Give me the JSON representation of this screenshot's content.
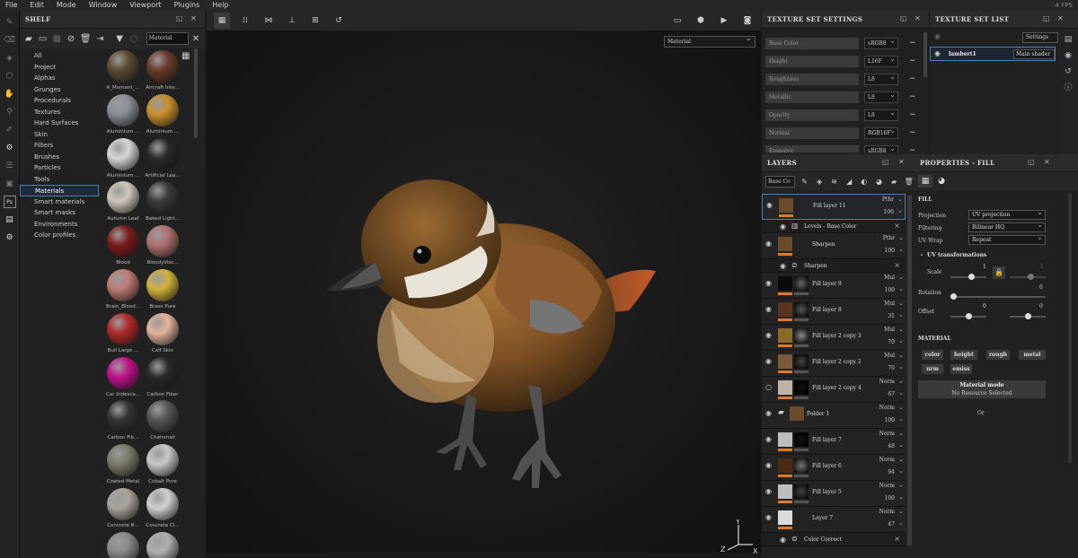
{
  "app": {
    "fps": "4 FPS"
  },
  "menu": [
    "File",
    "Edit",
    "Mode",
    "Window",
    "Viewport",
    "Plugins",
    "Help"
  ],
  "shelf": {
    "title": "SHELF",
    "search_value": "Material",
    "categories": [
      "All",
      "Project",
      "Alphas",
      "Grunges",
      "Procedurals",
      "Textures",
      "Hard Surfaces",
      "Skin",
      "Filters",
      "Brushes",
      "Particles",
      "Tools",
      "Materials",
      "Smart materials",
      "Smart masks",
      "Environments",
      "Color profiles"
    ],
    "selected_category": "Materials",
    "materials": [
      {
        "label": "A_Moment_...",
        "color": "#5a4a32"
      },
      {
        "label": "Aircraft Inte...",
        "color": "#6a3a2a"
      },
      {
        "label": "Aluminium ...",
        "color": "#8a8f95"
      },
      {
        "label": "Aluminium ...",
        "color": "#c9902c"
      },
      {
        "label": "Aluminium ...",
        "color": "#d8d8d8"
      },
      {
        "label": "Artificial Lea...",
        "color": "#2a2a2a"
      },
      {
        "label": "Autumn Leaf",
        "color": "#cfc7bb"
      },
      {
        "label": "Baked Light...",
        "color": "#3a3a3a"
      },
      {
        "label": "Blood",
        "color": "#7a1a1a"
      },
      {
        "label": "BloodyVisc...",
        "color": "#b07070"
      },
      {
        "label": "Brain_Blood...",
        "color": "#c07a74"
      },
      {
        "label": "Brass Pure",
        "color": "#d3b23a"
      },
      {
        "label": "Bull Large ...",
        "color": "#b02828"
      },
      {
        "label": "Calf Skin",
        "color": "#e4b39a"
      },
      {
        "label": "Car Iridesce...",
        "color": "#c0108a"
      },
      {
        "label": "Carbon Fiber",
        "color": "#2a2a2a"
      },
      {
        "label": "Carbon Fib...",
        "color": "#333333"
      },
      {
        "label": "Chainmail",
        "color": "#555555"
      },
      {
        "label": "Coated Metal",
        "color": "#7a7a68"
      },
      {
        "label": "Cobalt Pure",
        "color": "#c8c8c8"
      },
      {
        "label": "Concrete B...",
        "color": "#a8a49c"
      },
      {
        "label": "Concrete Cl...",
        "color": "#d0d0d0"
      },
      {
        "label": "",
        "color": "#8a8a8a"
      },
      {
        "label": "",
        "color": "#b0b0b0"
      }
    ]
  },
  "viewport": {
    "mode_select": "Material"
  },
  "texture_set_settings": {
    "title": "TEXTURE SET SETTINGS",
    "channels": [
      {
        "name": "Base Color",
        "format": "sRGB8"
      },
      {
        "name": "Height",
        "format": "L16F"
      },
      {
        "name": "Roughness",
        "format": "L8"
      },
      {
        "name": "Metallic",
        "format": "L8"
      },
      {
        "name": "Opacity",
        "format": "L8"
      },
      {
        "name": "Normal",
        "format": "RGB16F"
      },
      {
        "name": "Emissive",
        "format": "sRGB8"
      }
    ]
  },
  "texture_set_list": {
    "title": "TEXTURE SET LIST",
    "settings_label": "Settings",
    "item_name": "lambert1",
    "item_shader": "Main shader"
  },
  "layers": {
    "title": "LAYERS",
    "channel_select": "Base Co",
    "rows": [
      {
        "kind": "layer",
        "name": "Fill layer 11",
        "blend": "Pthr",
        "opacity": "100",
        "thumb": "#6a4a2a",
        "mask": "",
        "selected": true,
        "visible": true
      },
      {
        "kind": "sub",
        "name": "Levels - Base Color",
        "icon": "levels-icon"
      },
      {
        "kind": "layer",
        "name": "Sharpen",
        "blend": "Pthr",
        "opacity": "100",
        "thumb": "#6a4a2a",
        "mask": "",
        "selected": false,
        "visible": true
      },
      {
        "kind": "sub",
        "name": "Sharpen",
        "icon": "filter-icon"
      },
      {
        "kind": "layer",
        "name": "Fill layer 9",
        "blend": "Mul",
        "opacity": "100",
        "thumb": "#0a0a0a",
        "mask": "#666",
        "selected": false,
        "visible": true
      },
      {
        "kind": "layer",
        "name": "Fill layer 8",
        "blend": "Mul",
        "opacity": "31",
        "thumb": "#5a3220",
        "mask": "#555",
        "selected": false,
        "visible": true
      },
      {
        "kind": "layer",
        "name": "Fill layer 2 copy 3",
        "blend": "Mul",
        "opacity": "70",
        "thumb": "#8a6a2a",
        "mask": "#888",
        "selected": false,
        "visible": true
      },
      {
        "kind": "layer",
        "name": "Fill layer 2 copy 2",
        "blend": "Mul",
        "opacity": "70",
        "thumb": "#7a5a3a",
        "mask": "#444",
        "selected": false,
        "visible": true
      },
      {
        "kind": "layer",
        "name": "Fill layer 2 copy 4",
        "blend": "Norm",
        "opacity": "67",
        "thumb": "#bdb4a6",
        "mask": "#111",
        "selected": false,
        "visible": false
      },
      {
        "kind": "folder",
        "name": "Folder 1",
        "blend": "Norm",
        "opacity": "100",
        "thumb": "#6a4a2a",
        "mask": "",
        "selected": false,
        "visible": true
      },
      {
        "kind": "layer",
        "name": "Fill layer 7",
        "blend": "Norm",
        "opacity": "48",
        "thumb": "#bdbdbd",
        "mask": "#111",
        "selected": false,
        "visible": true
      },
      {
        "kind": "layer",
        "name": "Fill layer 6",
        "blend": "Norm",
        "opacity": "94",
        "thumb": "#4a2a10",
        "mask": "#777",
        "selected": false,
        "visible": true
      },
      {
        "kind": "layer",
        "name": "Fill layer 5",
        "blend": "Norm",
        "opacity": "100",
        "thumb": "#bdbdbd",
        "mask": "#444",
        "selected": false,
        "visible": true
      },
      {
        "kind": "layer",
        "name": "Layer 7",
        "blend": "Norm",
        "opacity": "47",
        "thumb": "#dcdcdc",
        "mask": "",
        "selected": false,
        "visible": true
      },
      {
        "kind": "sub",
        "name": "Color Correct",
        "icon": "filter-icon"
      }
    ]
  },
  "properties": {
    "title": "PROPERTIES - FILL",
    "section_fill": "FILL",
    "projection_label": "Projection",
    "projection_value": "UV projection",
    "filtering_label": "Filtering",
    "filtering_value": "Bilinear HQ",
    "uvwrap_label": "UV Wrap",
    "uvwrap_value": "Repeat",
    "uv_transform_label": "UV transformations",
    "scale_label": "Scale",
    "scale_value": "1",
    "scale_value2": "1",
    "rotation_label": "Rotation",
    "rotation_value": "0",
    "offset_label": "Offset",
    "offset_value_u": "0",
    "offset_value_v": "0",
    "section_material": "MATERIAL",
    "material_chips": [
      "color",
      "height",
      "rough",
      "metal",
      "nrm",
      "emiss"
    ],
    "material_mode_label": "Material mode",
    "material_mode_value": "No Resource Selected",
    "ok_text": "Or"
  },
  "colors": {
    "accent": "#4c7eb3",
    "orange": "#e07a20"
  }
}
